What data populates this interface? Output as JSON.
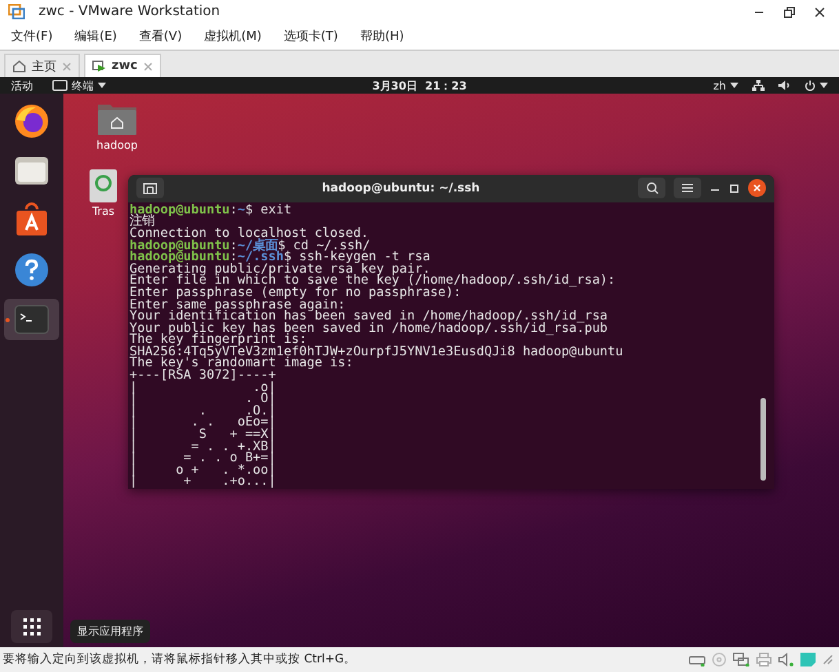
{
  "window": {
    "title": "zwc - VMware Workstation"
  },
  "menu": [
    "文件(F)",
    "编辑(E)",
    "查看(V)",
    "虚拟机(M)",
    "选项卡(T)",
    "帮助(H)"
  ],
  "tabs": [
    {
      "kind": "home",
      "label": "主页",
      "selected": false
    },
    {
      "kind": "vm",
      "label": "zwc",
      "selected": true
    }
  ],
  "top_bar": {
    "activities": "活动",
    "app": "终端",
    "clock": "3月30日  21：23",
    "input_method": "zh"
  },
  "dock": [
    {
      "kind": "firefox",
      "selected": false
    },
    {
      "kind": "files",
      "selected": false
    },
    {
      "kind": "software",
      "selected": false
    },
    {
      "kind": "help",
      "selected": false
    },
    {
      "kind": "terminal",
      "selected": true
    }
  ],
  "apps_tooltip": "显示应用程序",
  "desktop_icons": [
    {
      "kind": "folder",
      "label": "hadoop"
    },
    {
      "kind": "trash",
      "label": "Tras"
    }
  ],
  "terminal": {
    "title": "hadoop@ubuntu: ~/.ssh",
    "lines": [
      {
        "parts": [
          {
            "kind": "user",
            "text": "hadoop@ubuntu"
          },
          {
            "kind": "plain",
            "text": ":"
          },
          {
            "kind": "path",
            "text": "~"
          },
          {
            "kind": "plain",
            "text": "$ exit"
          }
        ]
      },
      {
        "parts": [
          {
            "kind": "plain",
            "text": "注销"
          }
        ]
      },
      {
        "parts": [
          {
            "kind": "plain",
            "text": "Connection to localhost closed."
          }
        ]
      },
      {
        "parts": [
          {
            "kind": "user",
            "text": "hadoop@ubuntu"
          },
          {
            "kind": "plain",
            "text": ":"
          },
          {
            "kind": "path",
            "text": "~/桌面"
          },
          {
            "kind": "plain",
            "text": "$ cd ~/.ssh/"
          }
        ]
      },
      {
        "parts": [
          {
            "kind": "user",
            "text": "hadoop@ubuntu"
          },
          {
            "kind": "plain",
            "text": ":"
          },
          {
            "kind": "path",
            "text": "~/.ssh"
          },
          {
            "kind": "plain",
            "text": "$ ssh-keygen -t rsa"
          }
        ]
      },
      {
        "parts": [
          {
            "kind": "plain",
            "text": "Generating public/private rsa key pair."
          }
        ]
      },
      {
        "parts": [
          {
            "kind": "plain",
            "text": "Enter file in which to save the key (/home/hadoop/.ssh/id_rsa):"
          }
        ]
      },
      {
        "parts": [
          {
            "kind": "plain",
            "text": "Enter passphrase (empty for no passphrase):"
          }
        ]
      },
      {
        "parts": [
          {
            "kind": "plain",
            "text": "Enter same passphrase again:"
          }
        ]
      },
      {
        "parts": [
          {
            "kind": "plain",
            "text": "Your identification has been saved in /home/hadoop/.ssh/id_rsa"
          }
        ]
      },
      {
        "parts": [
          {
            "kind": "plain",
            "text": "Your public key has been saved in /home/hadoop/.ssh/id_rsa.pub"
          }
        ]
      },
      {
        "parts": [
          {
            "kind": "plain",
            "text": "The key fingerprint is:"
          }
        ]
      },
      {
        "parts": [
          {
            "kind": "plain",
            "text": "SHA256:4Tq5yVTeV3zm1ef0hTJW+zOurpfJ5YNV1e3EusdQJi8 hadoop@ubuntu"
          }
        ]
      },
      {
        "parts": [
          {
            "kind": "plain",
            "text": "The key's randomart image is:"
          }
        ]
      },
      {
        "parts": [
          {
            "kind": "plain",
            "text": "+---[RSA 3072]----+"
          }
        ]
      },
      {
        "parts": [
          {
            "kind": "plain",
            "text": "|               .o|"
          }
        ]
      },
      {
        "parts": [
          {
            "kind": "plain",
            "text": "|              . O|"
          }
        ]
      },
      {
        "parts": [
          {
            "kind": "plain",
            "text": "|        .     .O.|"
          }
        ]
      },
      {
        "parts": [
          {
            "kind": "plain",
            "text": "|       . .   oEo=|"
          }
        ]
      },
      {
        "parts": [
          {
            "kind": "plain",
            "text": "|        S   + ==X|"
          }
        ]
      },
      {
        "parts": [
          {
            "kind": "plain",
            "text": "|       = . . +.XB|"
          }
        ]
      },
      {
        "parts": [
          {
            "kind": "plain",
            "text": "|      = . . o B+=|"
          }
        ]
      },
      {
        "parts": [
          {
            "kind": "plain",
            "text": "|     o +   . *.oo|"
          }
        ]
      },
      {
        "parts": [
          {
            "kind": "plain",
            "text": "|      +    .+o...|"
          }
        ]
      }
    ]
  },
  "status_bar": {
    "message": "要将输入定向到该虚拟机，请将鼠标指针移入其中或按 Ctrl+G。"
  }
}
